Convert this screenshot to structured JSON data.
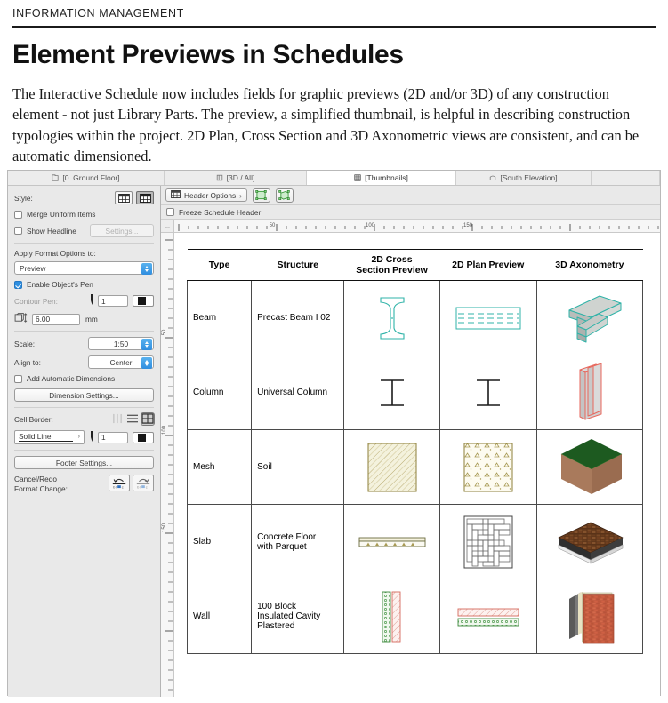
{
  "article": {
    "kicker": "INFORMATION MANAGEMENT",
    "title": "Element Previews in Schedules",
    "body": "The Interactive Schedule now includes fields for graphic previews (2D and/or 3D) of any construction element - not just Library Parts. The preview, a simplified thumbnail, is helpful in describing construction typologies within the project. 2D Plan, Cross Section and 3D Axonometric views are consistent, and can be automatic dimensioned."
  },
  "app": {
    "tabs": [
      {
        "label": "[0. Ground Floor]",
        "icon": "floor-plan-icon",
        "active": false
      },
      {
        "label": "[3D / All]",
        "icon": "cube-icon",
        "active": false
      },
      {
        "label": "[Thumbnails]",
        "icon": "grid-icon",
        "active": true
      },
      {
        "label": "[South Elevation]",
        "icon": "elevation-icon",
        "active": false
      }
    ],
    "inspector": {
      "style_label": "Style:",
      "style_buttons": [
        "grid-style-simple",
        "grid-style-full"
      ],
      "style_selected_index": 1,
      "merge_uniform_items": {
        "label": "Merge Uniform Items",
        "checked": false
      },
      "show_headline": {
        "label": "Show Headline",
        "checked": false
      },
      "settings_button": "Settings...",
      "apply_format_label": "Apply Format Options to:",
      "apply_format_value": "Preview",
      "enable_objects_pen": {
        "label": "Enable Object's Pen",
        "checked": true
      },
      "contour_pen_label": "Contour Pen:",
      "contour_pen_value": "1",
      "size_value": "6.00",
      "size_unit": "mm",
      "scale_label": "Scale:",
      "scale_value": "1:50",
      "align_label": "Align to:",
      "align_value": "Center",
      "add_auto_dimensions": {
        "label": "Add Automatic Dimensions",
        "checked": false
      },
      "dimension_settings_button": "Dimension Settings...",
      "cell_border_label": "Cell Border:",
      "cell_border_icons": [
        "border-vertical-icon",
        "border-horizontal-icon",
        "border-all-icon"
      ],
      "cell_border_selected_index": 2,
      "line_type_value": "Solid Line",
      "line_pen_value": "1",
      "footer_settings_button": "Footer Settings...",
      "cancel_redo_label_line1": "Cancel/Redo",
      "cancel_redo_label_line2": "Format Change:"
    },
    "toolbar": {
      "header_options": "Header Options",
      "freeze_header": {
        "label": "Freeze Schedule Header",
        "checked": false
      },
      "ruler_corner": "...",
      "h_ruler_ticks": [
        "50",
        "100",
        "150"
      ],
      "v_ruler_ticks": [
        "50",
        "100",
        "150"
      ]
    }
  },
  "schedule": {
    "columns": [
      "Type",
      "Structure",
      "2D Cross\nSection Preview",
      "2D Plan Preview",
      "3D Axonometry"
    ],
    "column_headers": [
      {
        "line1": "Type",
        "line2": ""
      },
      {
        "line1": "Structure",
        "line2": ""
      },
      {
        "line1": "2D Cross",
        "line2": "Section Preview"
      },
      {
        "line1": "2D Plan Preview",
        "line2": ""
      },
      {
        "line1": "3D Axonometry",
        "line2": ""
      }
    ],
    "rows": [
      {
        "type": "Beam",
        "structure": "Precast Beam I 02",
        "xs": "i-beam-section-teal",
        "plan": "beam-plan-dashed-teal",
        "axo": "beam-3d-teal",
        "accent": "#2fb3a8"
      },
      {
        "type": "Column",
        "structure": "Universal Column",
        "xs": "i-beam-section-black",
        "plan": "column-plan-black",
        "axo": "column-3d-red",
        "accent": "#e8675c"
      },
      {
        "type": "Mesh",
        "structure": "Soil",
        "xs": "soil-hatch-section",
        "plan": "soil-plan-dots",
        "axo": "soil-3d-brown",
        "accent": "#8d7f3a"
      },
      {
        "type": "Slab",
        "structure": "Concrete Floor\nwith Parquet",
        "xs": "slab-section",
        "plan": "parquet-plan",
        "axo": "slab-3d-parquet",
        "accent": "#6b6b3f"
      },
      {
        "type": "Wall",
        "structure": "100 Block\nInsulated Cavity\nPlastered",
        "xs": "wall-section",
        "plan": "wall-plan",
        "axo": "wall-3d-brick",
        "accent": "#cf5c4d"
      }
    ],
    "row_structure_lines": [
      [
        "Precast Beam I 02"
      ],
      [
        "Universal Column"
      ],
      [
        "Soil"
      ],
      [
        "Concrete Floor",
        "with Parquet"
      ],
      [
        "100 Block",
        "Insulated Cavity",
        "Plastered"
      ]
    ]
  },
  "colors": {
    "teal": "#2fb3a8",
    "salmon": "#e8675c",
    "brick": "#c25a3f",
    "soil_brown": "#a97a5c",
    "grass_green": "#1d5a20",
    "parquet_brown": "#5a3318",
    "accent_blue": "#2f8ddf"
  }
}
